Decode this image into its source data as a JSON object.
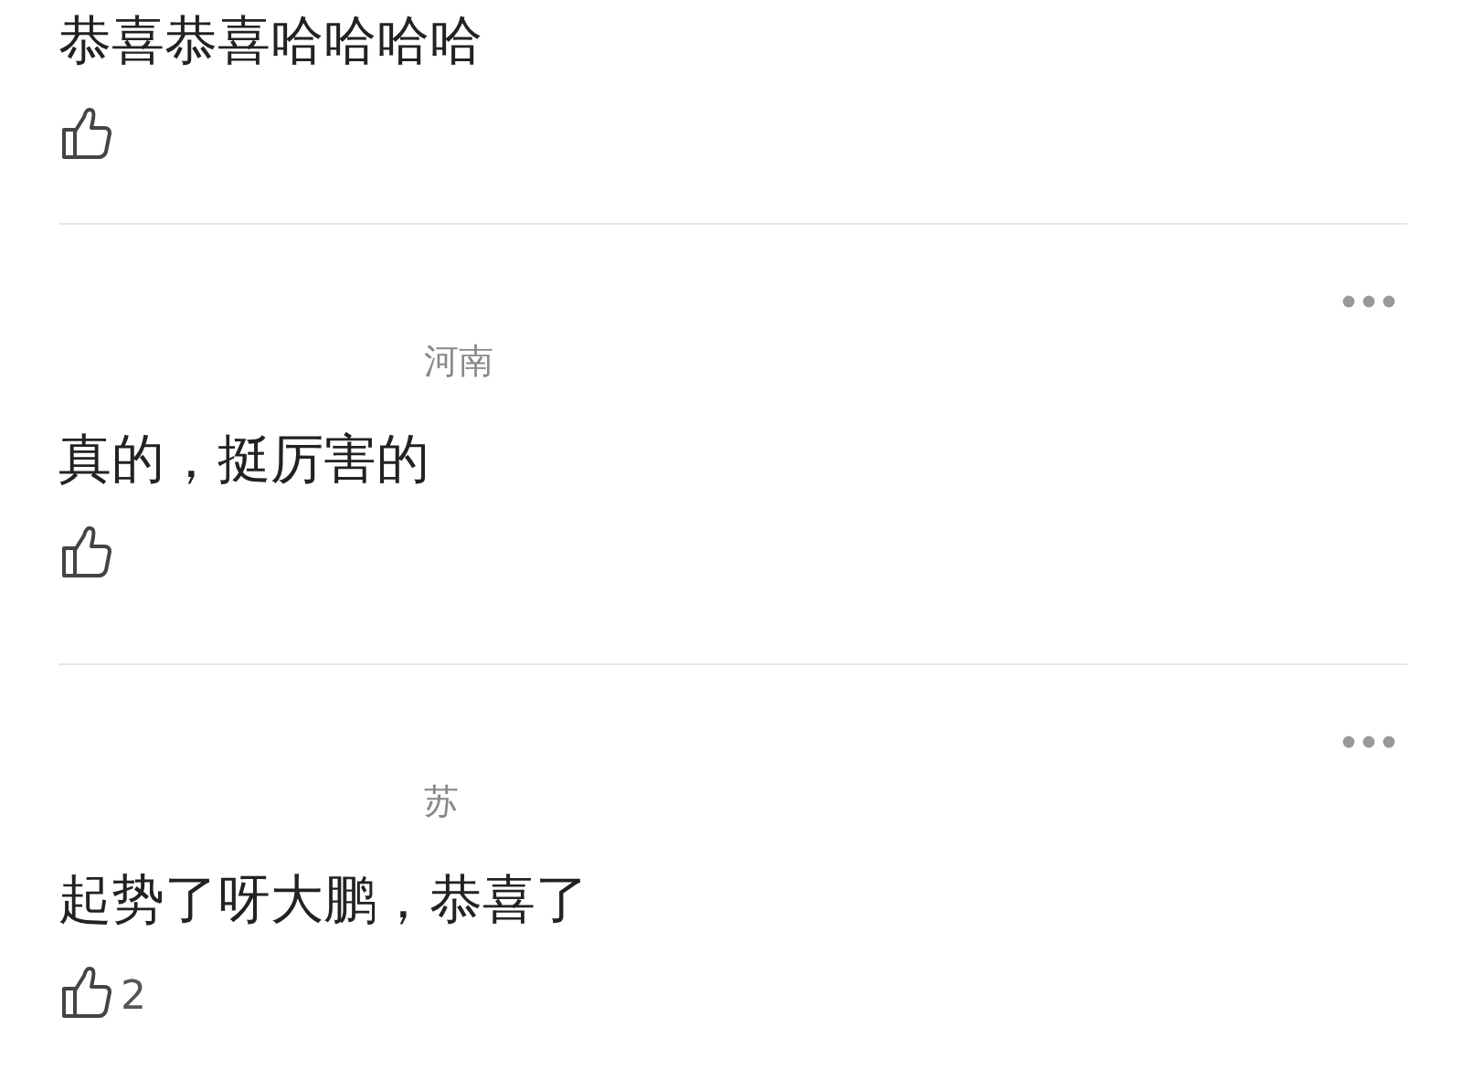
{
  "comments": [
    {
      "text": "恭喜恭喜哈哈哈哈",
      "more_menu": false
    },
    {
      "location": "河南",
      "text": "真的，挺厉害的",
      "more_menu": true
    },
    {
      "location": "苏",
      "text": "起势了呀大鹏，恭喜了",
      "like_count": "2",
      "more_menu": true
    }
  ]
}
